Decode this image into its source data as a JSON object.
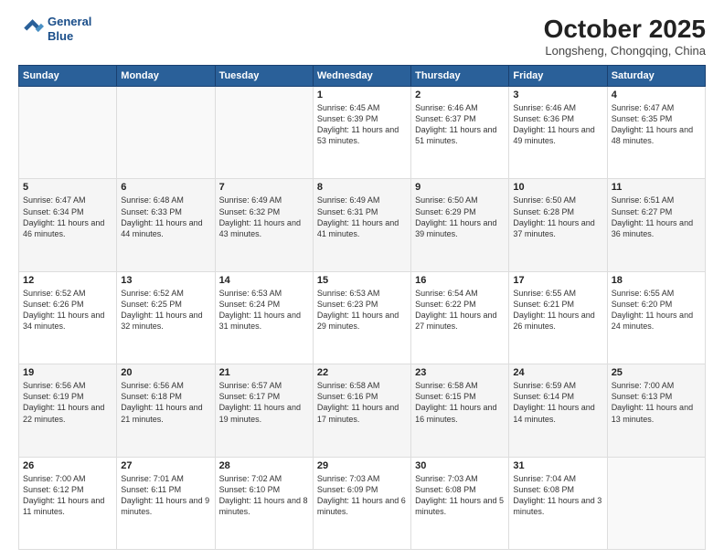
{
  "header": {
    "logo_line1": "General",
    "logo_line2": "Blue",
    "month_title": "October 2025",
    "location": "Longsheng, Chongqing, China"
  },
  "days_of_week": [
    "Sunday",
    "Monday",
    "Tuesday",
    "Wednesday",
    "Thursday",
    "Friday",
    "Saturday"
  ],
  "weeks": [
    [
      {
        "day": "",
        "text": ""
      },
      {
        "day": "",
        "text": ""
      },
      {
        "day": "",
        "text": ""
      },
      {
        "day": "1",
        "text": "Sunrise: 6:45 AM\nSunset: 6:39 PM\nDaylight: 11 hours and 53 minutes."
      },
      {
        "day": "2",
        "text": "Sunrise: 6:46 AM\nSunset: 6:37 PM\nDaylight: 11 hours and 51 minutes."
      },
      {
        "day": "3",
        "text": "Sunrise: 6:46 AM\nSunset: 6:36 PM\nDaylight: 11 hours and 49 minutes."
      },
      {
        "day": "4",
        "text": "Sunrise: 6:47 AM\nSunset: 6:35 PM\nDaylight: 11 hours and 48 minutes."
      }
    ],
    [
      {
        "day": "5",
        "text": "Sunrise: 6:47 AM\nSunset: 6:34 PM\nDaylight: 11 hours and 46 minutes."
      },
      {
        "day": "6",
        "text": "Sunrise: 6:48 AM\nSunset: 6:33 PM\nDaylight: 11 hours and 44 minutes."
      },
      {
        "day": "7",
        "text": "Sunrise: 6:49 AM\nSunset: 6:32 PM\nDaylight: 11 hours and 43 minutes."
      },
      {
        "day": "8",
        "text": "Sunrise: 6:49 AM\nSunset: 6:31 PM\nDaylight: 11 hours and 41 minutes."
      },
      {
        "day": "9",
        "text": "Sunrise: 6:50 AM\nSunset: 6:29 PM\nDaylight: 11 hours and 39 minutes."
      },
      {
        "day": "10",
        "text": "Sunrise: 6:50 AM\nSunset: 6:28 PM\nDaylight: 11 hours and 37 minutes."
      },
      {
        "day": "11",
        "text": "Sunrise: 6:51 AM\nSunset: 6:27 PM\nDaylight: 11 hours and 36 minutes."
      }
    ],
    [
      {
        "day": "12",
        "text": "Sunrise: 6:52 AM\nSunset: 6:26 PM\nDaylight: 11 hours and 34 minutes."
      },
      {
        "day": "13",
        "text": "Sunrise: 6:52 AM\nSunset: 6:25 PM\nDaylight: 11 hours and 32 minutes."
      },
      {
        "day": "14",
        "text": "Sunrise: 6:53 AM\nSunset: 6:24 PM\nDaylight: 11 hours and 31 minutes."
      },
      {
        "day": "15",
        "text": "Sunrise: 6:53 AM\nSunset: 6:23 PM\nDaylight: 11 hours and 29 minutes."
      },
      {
        "day": "16",
        "text": "Sunrise: 6:54 AM\nSunset: 6:22 PM\nDaylight: 11 hours and 27 minutes."
      },
      {
        "day": "17",
        "text": "Sunrise: 6:55 AM\nSunset: 6:21 PM\nDaylight: 11 hours and 26 minutes."
      },
      {
        "day": "18",
        "text": "Sunrise: 6:55 AM\nSunset: 6:20 PM\nDaylight: 11 hours and 24 minutes."
      }
    ],
    [
      {
        "day": "19",
        "text": "Sunrise: 6:56 AM\nSunset: 6:19 PM\nDaylight: 11 hours and 22 minutes."
      },
      {
        "day": "20",
        "text": "Sunrise: 6:56 AM\nSunset: 6:18 PM\nDaylight: 11 hours and 21 minutes."
      },
      {
        "day": "21",
        "text": "Sunrise: 6:57 AM\nSunset: 6:17 PM\nDaylight: 11 hours and 19 minutes."
      },
      {
        "day": "22",
        "text": "Sunrise: 6:58 AM\nSunset: 6:16 PM\nDaylight: 11 hours and 17 minutes."
      },
      {
        "day": "23",
        "text": "Sunrise: 6:58 AM\nSunset: 6:15 PM\nDaylight: 11 hours and 16 minutes."
      },
      {
        "day": "24",
        "text": "Sunrise: 6:59 AM\nSunset: 6:14 PM\nDaylight: 11 hours and 14 minutes."
      },
      {
        "day": "25",
        "text": "Sunrise: 7:00 AM\nSunset: 6:13 PM\nDaylight: 11 hours and 13 minutes."
      }
    ],
    [
      {
        "day": "26",
        "text": "Sunrise: 7:00 AM\nSunset: 6:12 PM\nDaylight: 11 hours and 11 minutes."
      },
      {
        "day": "27",
        "text": "Sunrise: 7:01 AM\nSunset: 6:11 PM\nDaylight: 11 hours and 9 minutes."
      },
      {
        "day": "28",
        "text": "Sunrise: 7:02 AM\nSunset: 6:10 PM\nDaylight: 11 hours and 8 minutes."
      },
      {
        "day": "29",
        "text": "Sunrise: 7:03 AM\nSunset: 6:09 PM\nDaylight: 11 hours and 6 minutes."
      },
      {
        "day": "30",
        "text": "Sunrise: 7:03 AM\nSunset: 6:08 PM\nDaylight: 11 hours and 5 minutes."
      },
      {
        "day": "31",
        "text": "Sunrise: 7:04 AM\nSunset: 6:08 PM\nDaylight: 11 hours and 3 minutes."
      },
      {
        "day": "",
        "text": ""
      }
    ]
  ]
}
